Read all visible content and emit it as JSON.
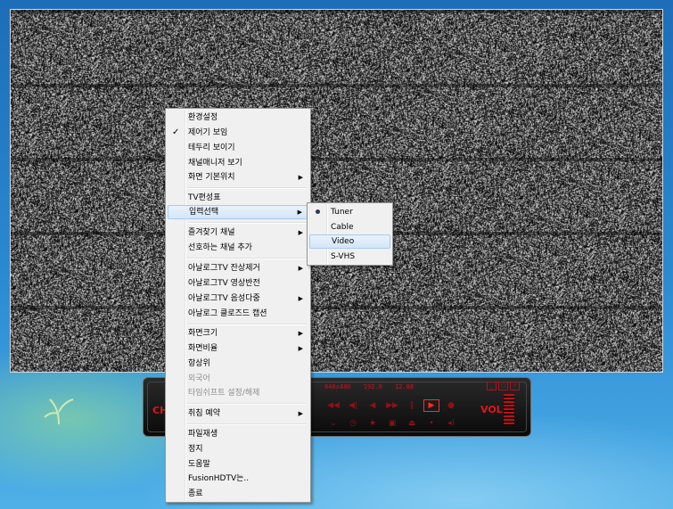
{
  "player": {
    "channel_label": "CH",
    "volume_label": "VOL",
    "lcd": [
      "640x480",
      "192.0",
      "12.88"
    ]
  },
  "menu": {
    "items": [
      {
        "label": "환경설정"
      },
      {
        "label": "제어기 보임",
        "checked": true
      },
      {
        "label": "테두리 보이기"
      },
      {
        "label": "채널매니저 보기"
      },
      {
        "label": "화면 기본위치",
        "submenu": true
      },
      {
        "label": "TV편성표"
      },
      {
        "label": "입력선택",
        "submenu": true,
        "highlighted": true
      },
      {
        "label": "즐겨찾기 채널",
        "submenu": true
      },
      {
        "label": "선호하는 채널 추가"
      },
      {
        "label": "아날로그TV 잔상제거",
        "submenu": true
      },
      {
        "label": "아날로그TV 영상반전"
      },
      {
        "label": "아날로그TV 음성다중",
        "submenu": true
      },
      {
        "label": "아날로그 클로즈드 캡션"
      },
      {
        "label": "화면크기",
        "submenu": true
      },
      {
        "label": "화면비율",
        "submenu": true
      },
      {
        "label": "항상위"
      },
      {
        "label": "외국어",
        "disabled": true
      },
      {
        "label": "타임쉬프트 설정/해제",
        "disabled": true
      },
      {
        "label": "취침 예약",
        "submenu": true
      },
      {
        "label": "파일재생"
      },
      {
        "label": "정지"
      },
      {
        "label": "도움말"
      },
      {
        "label": "FusionHDTV는.."
      },
      {
        "label": "종료"
      }
    ]
  },
  "input_submenu": {
    "items": [
      {
        "label": "Tuner",
        "selected": true
      },
      {
        "label": "Cable"
      },
      {
        "label": "Video",
        "highlighted": true
      },
      {
        "label": "S-VHS"
      }
    ]
  }
}
